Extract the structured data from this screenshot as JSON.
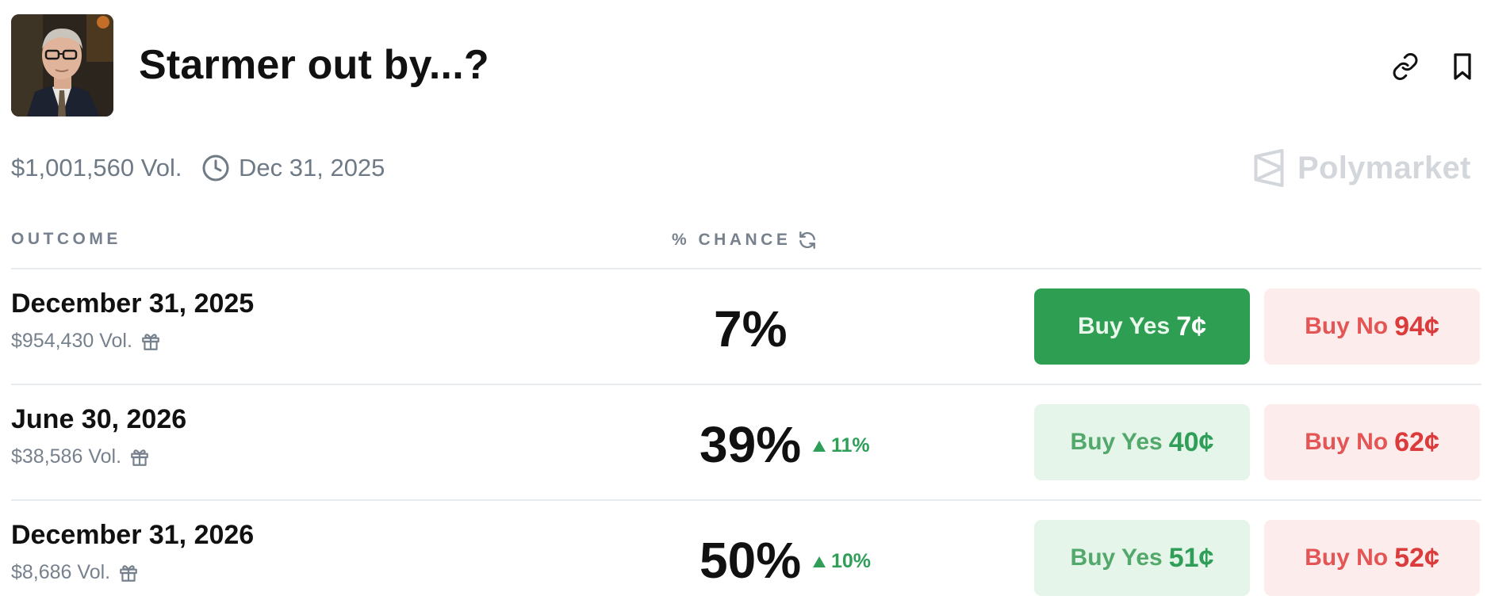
{
  "market": {
    "title": "Starmer out by...?",
    "volume": "$1,001,560 Vol.",
    "end_date": "Dec 31, 2025",
    "brand": "Polymarket",
    "avatar": "portrait-photo"
  },
  "toolbar": {
    "link_icon": "link-icon",
    "bookmark_icon": "bookmark-icon"
  },
  "table": {
    "col_outcome": "OUTCOME",
    "col_chance": "% CHANCE",
    "rows": [
      {
        "name": "December 31, 2025",
        "volume": "$954,430 Vol.",
        "chance": "7%",
        "delta": "",
        "buy_yes_label": "Buy Yes",
        "buy_yes_price": "7¢",
        "buy_no_label": "Buy No",
        "buy_no_price": "94¢"
      },
      {
        "name": "June 30, 2026",
        "volume": "$38,586 Vol.",
        "chance": "39%",
        "delta": "11%",
        "buy_yes_label": "Buy Yes",
        "buy_yes_price": "40¢",
        "buy_no_label": "Buy No",
        "buy_no_price": "62¢"
      },
      {
        "name": "December 31, 2026",
        "volume": "$8,686 Vol.",
        "chance": "50%",
        "delta": "10%",
        "buy_yes_label": "Buy Yes",
        "buy_yes_price": "51¢",
        "buy_no_label": "Buy No",
        "buy_no_price": "52¢"
      }
    ]
  },
  "colors": {
    "yes_active": "#2e9e52",
    "yes_light": "#e6f5e9",
    "no_light": "#fdecec",
    "no_text": "#dc3b3b",
    "delta_up": "#2f9e58",
    "muted": "#77818d"
  }
}
